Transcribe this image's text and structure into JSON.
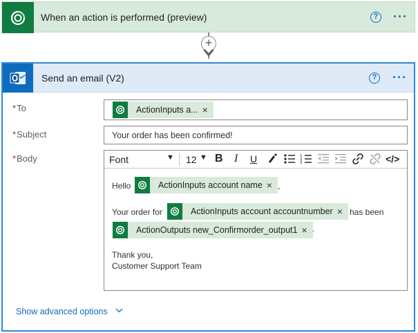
{
  "trigger": {
    "title": "When an action is performed (preview)",
    "icon": "dataverse-icon",
    "help_glyph": "?",
    "more_glyph": "···"
  },
  "connector": {
    "add_glyph": "+"
  },
  "action": {
    "title": "Send an email (V2)",
    "icon": "outlook-icon",
    "help_glyph": "?",
    "more_glyph": "···",
    "to": {
      "required_mark": "*",
      "label": "To",
      "token": "ActionInputs a..."
    },
    "subject": {
      "required_mark": "*",
      "label": "Subject",
      "value": "Your order has been confirmed!"
    },
    "body": {
      "required_mark": "*",
      "label": "Body",
      "toolbar": {
        "font": "Font",
        "size": "12",
        "bold": "B",
        "italic": "I",
        "underline": "U",
        "code": "</>"
      },
      "hello": "Hello",
      "token_name": "ActionInputs account name",
      "comma1": ",",
      "order_for": "Your order for",
      "token_number": "ActionInputs account accountnumber",
      "has_been": "has been",
      "token_output": "ActionOutputs new_Confirmorder_output1",
      "period": ".",
      "thanks": "Thank you,",
      "team": "Customer Support Team"
    },
    "advanced": "Show advanced options"
  },
  "token_remove_glyph": "×",
  "colors": {
    "dataverse_green": "#107c41",
    "token_bg": "#d8eadb",
    "accent_blue": "#0f6cbd",
    "header_blue": "#deeaf8",
    "required_red": "#a4262c"
  }
}
